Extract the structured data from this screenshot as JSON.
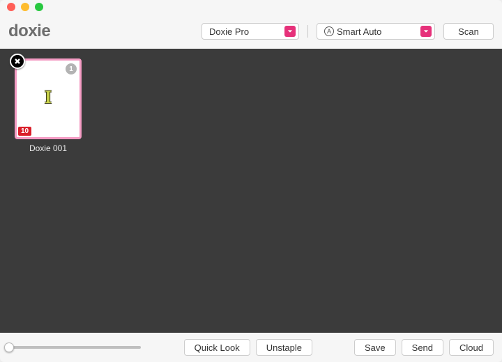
{
  "app": {
    "name": "doxie"
  },
  "titlebar": {},
  "toolbar": {
    "device_label": "Doxie Pro",
    "mode_prefix": "A",
    "mode_label": "Smart Auto",
    "scan_label": "Scan"
  },
  "stage": {
    "items": [
      {
        "name": "Doxie 001",
        "corner_badge": "1",
        "red_badge": "10",
        "center_glyph": "I"
      }
    ]
  },
  "footer": {
    "quick_look_label": "Quick Look",
    "unstaple_label": "Unstaple",
    "save_label": "Save",
    "send_label": "Send",
    "cloud_label": "Cloud"
  }
}
